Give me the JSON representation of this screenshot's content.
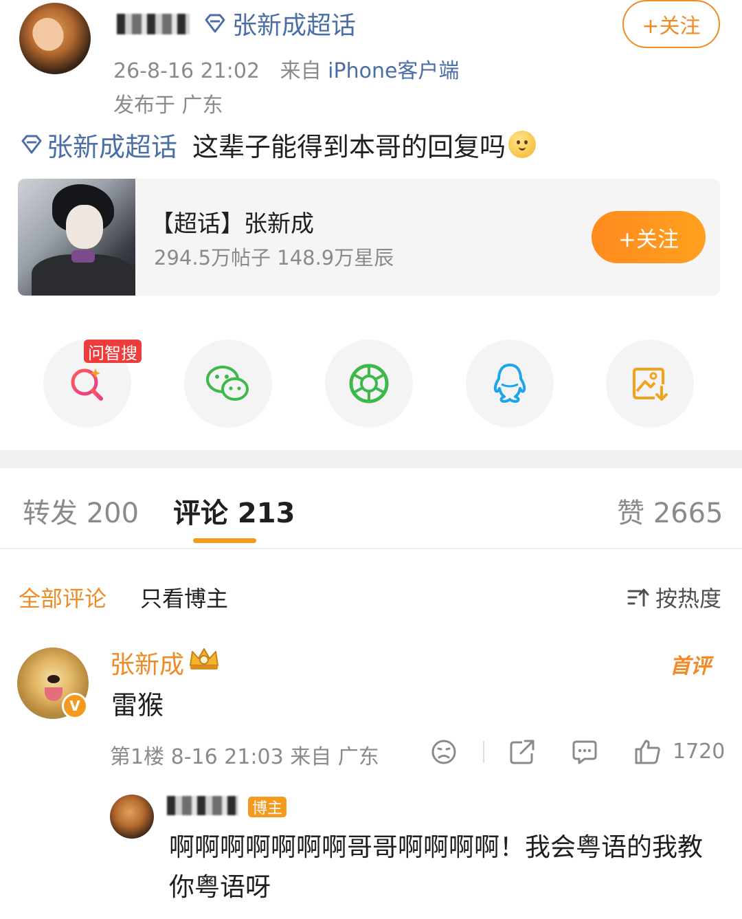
{
  "post": {
    "author_name": "",
    "topic_tag": "张新成超话",
    "timestamp": "26-8-16 21:02",
    "source_prefix": "来自",
    "source": "iPhone客户端",
    "location": "发布于 广东",
    "follow_label": "+关注",
    "body_topic": "张新成超话",
    "body_text": "这辈子能得到本哥的回复吗"
  },
  "topic_card": {
    "title": "【超话】张新成",
    "stats": "294.5万帖子 148.9万星辰",
    "follow_label": "+关注"
  },
  "share": {
    "ai_search_badge": "问智搜",
    "items": [
      "ai-search",
      "wechat",
      "moments",
      "qq",
      "save-image"
    ]
  },
  "tabs": {
    "repost": "转发 200",
    "comments": "评论 213",
    "likes": "赞 2665",
    "active": "comments"
  },
  "filters": {
    "all": "全部评论",
    "owner_only": "只看博主",
    "sort": "按热度"
  },
  "comment": {
    "author": "张新成",
    "tag": "首评",
    "text": "雷猴",
    "meta": "第1楼  8-16 21:03  来自 广东",
    "likes": "1720",
    "reply": {
      "badge": "博主",
      "text": "啊啊啊啊啊啊啊哥哥啊啊啊啊！我会粤语的我教你粤语呀"
    }
  },
  "colors": {
    "accent": "#f08a24",
    "link": "#4a6ea5",
    "muted": "#8a8a8a"
  }
}
